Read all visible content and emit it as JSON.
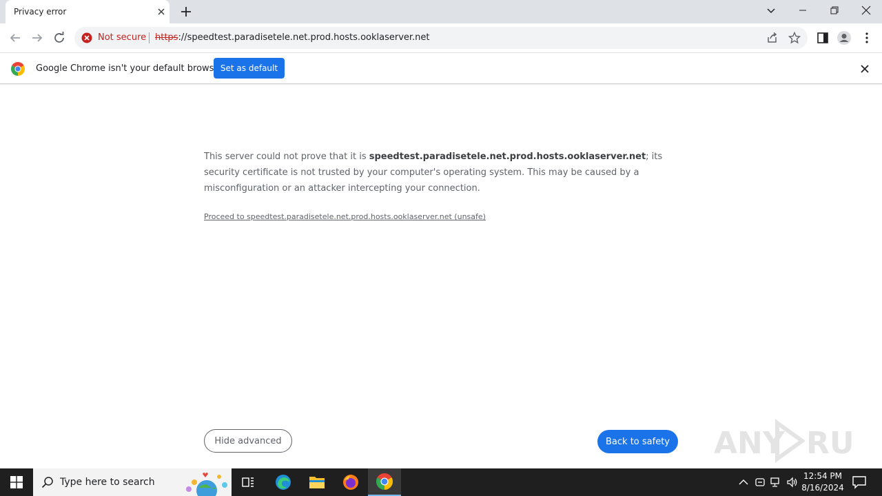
{
  "tab": {
    "title": "Privacy error"
  },
  "omnibox": {
    "security_label": "Not secure",
    "url_scheme": "https",
    "url_rest": "://speedtest.paradisetele.net.prod.hosts.ooklaserver.net"
  },
  "infobar": {
    "message": "Google Chrome isn't your default browser",
    "button_label": "Set as default"
  },
  "page": {
    "text_before": "This server could not prove that it is ",
    "host": "speedtest.paradisetele.net.prod.hosts.ooklaserver.net",
    "text_after": "; its security certificate is not trusted by your computer's operating system. This may be caused by a misconfiguration or an attacker intercepting your connection.",
    "proceed_link": "Proceed to speedtest.paradisetele.net.prod.hosts.ooklaserver.net (unsafe)",
    "hide_advanced": "Hide advanced",
    "back_to_safety": "Back to safety"
  },
  "taskbar": {
    "search_placeholder": "Type here to search",
    "time": "12:54 PM",
    "date": "8/16/2024"
  },
  "colors": {
    "accent": "#1a73e8",
    "danger": "#c5221f",
    "taskbar": "#1f1f1f"
  }
}
